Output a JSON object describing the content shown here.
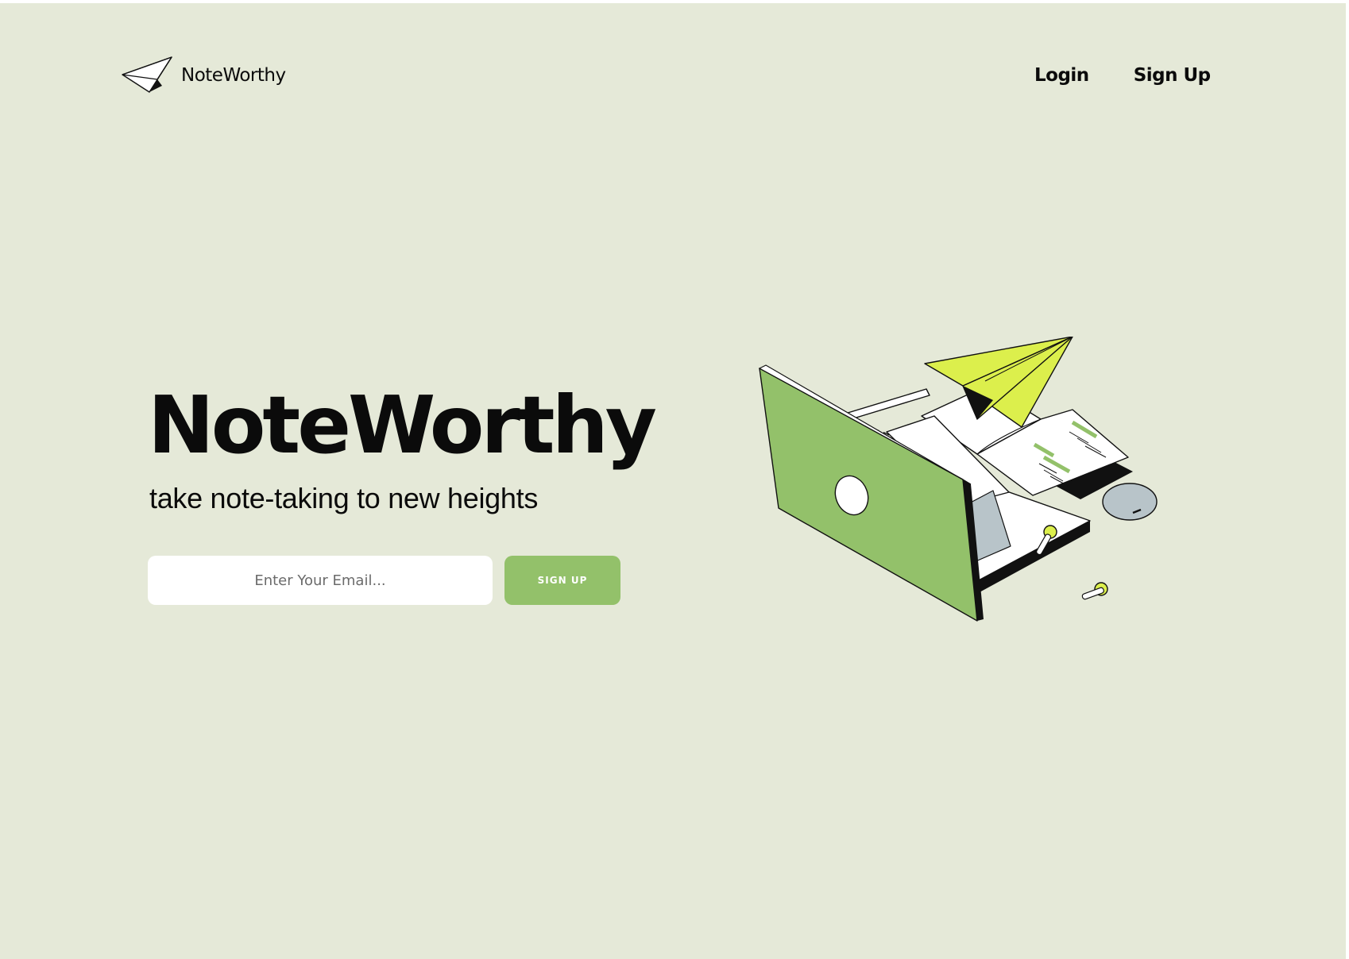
{
  "brand": {
    "name": "NoteWorthy",
    "logo_icon": "paper-plane-icon"
  },
  "nav": {
    "login_label": "Login",
    "signup_label": "Sign Up"
  },
  "hero": {
    "title": "NoteWorthy",
    "subtitle": "take note-taking to new heights",
    "email_placeholder": "Enter Your Email...",
    "signup_button_label": "SIGN UP"
  },
  "illustration": {
    "name": "laptop-paper-plane-illustration"
  },
  "colors": {
    "background": "#e5e9d8",
    "accent_green": "#93c16a",
    "plane_lime": "#dcef4c",
    "device_gray": "#b8c4c9",
    "text": "#0b0b0b",
    "input_bg": "#ffffff"
  }
}
